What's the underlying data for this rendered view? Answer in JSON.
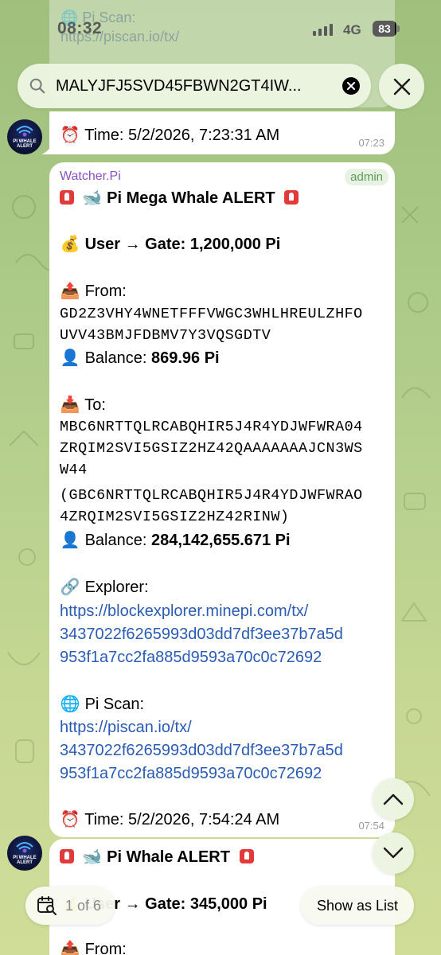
{
  "status": {
    "time": "08:32",
    "network": "4G",
    "battery": "83"
  },
  "ghost": {
    "line1": "🌐 Pi Scan:",
    "line2": "https://piscan.io/tx/"
  },
  "search": {
    "value": "MALYJFJ5SVD45FBWN2GT4IW..."
  },
  "avatar": {
    "line1": "PI WHALE",
    "line2": "ALERT"
  },
  "prev_message": {
    "time_line": "Time: 5/2/2026, 7:23:31 AM",
    "timestamp": "07:23"
  },
  "message": {
    "sender": "Watcher.Pi",
    "badge": "admin",
    "title": "Pi Mega Whale ALERT",
    "user_gate_label": "User → Gate:",
    "user_gate_value": "1,200,000 Pi",
    "from_label": "From:",
    "from_address_1": "GD2Z3VHY4WNETFFFVWGC3WHLHREULZHFO",
    "from_address_2": "UVV43BMJFDBMV7Y3VQSGDTV",
    "balance_label": "Balance:",
    "from_balance": "869.96 Pi",
    "to_label": "To:",
    "to_address_1": "MBC6NRTTQLRCABQHIR5J4R4YDJWFWRA04",
    "to_address_2": "ZRQIM2SVI5GSIZ2HZ42QAAAAAAAJCN3WS",
    "to_address_3": "W44",
    "to_address_4": "(GBC6NRTTQLRCABQHIR5J4R4YDJWFWRAO",
    "to_address_5": "4ZRQIM2SVI5GSIZ2HZ42RINW)",
    "to_balance": "284,142,655.671 Pi",
    "explorer_label": "Explorer:",
    "explorer_link_1": "https://blockexplorer.minepi.com/tx/",
    "explorer_link_2": "3437022f6265993d03dd7df3ee37b7a5d",
    "explorer_link_3": "953f1a7cc2fa885d9593a70c0c72692",
    "piscan_label": "Pi Scan:",
    "piscan_link_1": "https://piscan.io/tx/",
    "piscan_link_2": "3437022f6265993d03dd7df3ee37b7a5d",
    "piscan_link_3": "953f1a7cc2fa885d9593a70c0c72692",
    "time_line": "Time: 5/2/2026, 7:54:24 AM",
    "timestamp": "07:54"
  },
  "next_message": {
    "title": "Pi Whale ALERT",
    "user_gate_label": "User → Gate:",
    "user_gate_value": "345,000 Pi",
    "from_label": "From:"
  },
  "footer": {
    "pager": "1 of 6",
    "list_button": "Show as List"
  },
  "emojis": {
    "clock": "⏰",
    "money": "💰",
    "outbox": "📤",
    "inbox": "📥",
    "person": "👤",
    "link": "🔗",
    "globe": "🌐",
    "whale": "🐋"
  }
}
